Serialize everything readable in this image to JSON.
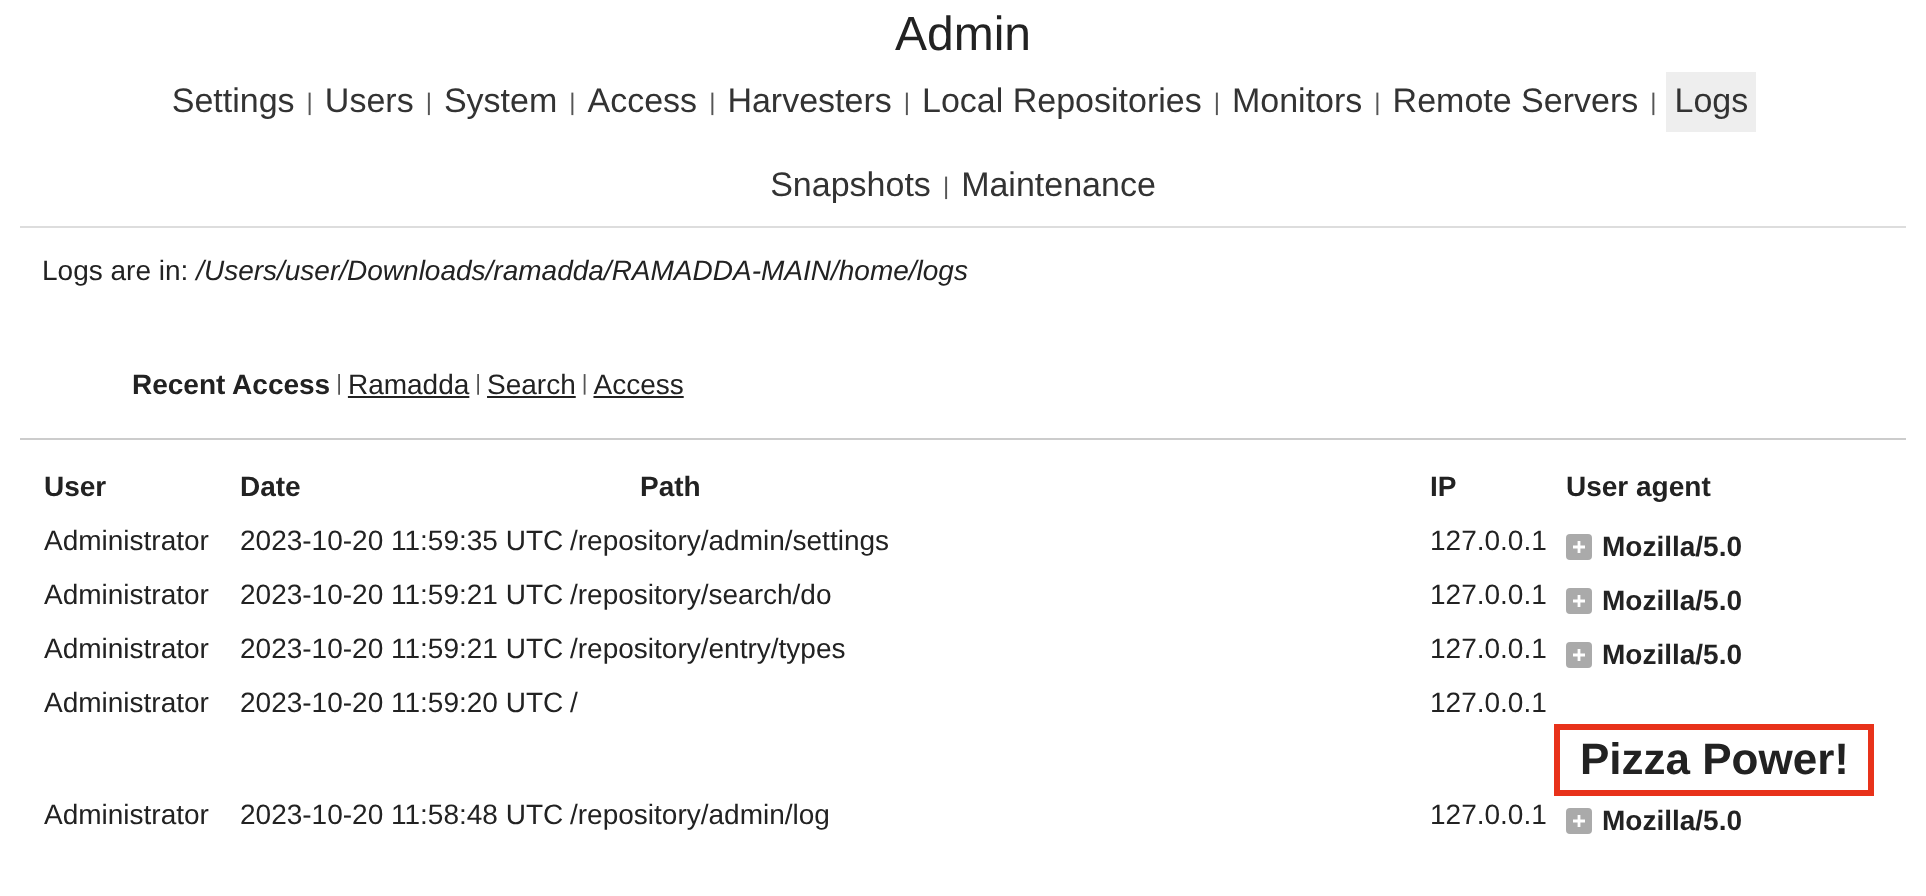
{
  "title": "Admin",
  "nav": [
    {
      "label": "Settings",
      "selected": false
    },
    {
      "separator": "|",
      "label": "Users",
      "selected": false
    },
    {
      "separator": "|",
      "label": "System",
      "selected": false
    },
    {
      "separator": "|",
      "label": "Access",
      "selected": false
    },
    {
      "separator": "|",
      "label": "Harvesters",
      "selected": false
    },
    {
      "separator": "|",
      "label": "Local Repositories",
      "selected": false
    },
    {
      "separator": "|",
      "label": "Monitors",
      "selected": false
    },
    {
      "separator": "|",
      "label": "Remote Servers",
      "selected": false
    },
    {
      "separator": "|",
      "label": "Logs",
      "selected": true
    },
    {
      "label": "Snapshots",
      "selected": false
    },
    {
      "separator": "|",
      "label": "Maintenance",
      "selected": false
    }
  ],
  "logs_location": {
    "label": "Logs are in:",
    "path": "/Users/user/Downloads/ramadda/RAMADDA-MAIN/home/logs"
  },
  "log_tabs": [
    {
      "label": "Recent Access",
      "selected": true
    },
    {
      "separator": "|",
      "label": "Ramadda",
      "selected": false
    },
    {
      "separator": "|",
      "label": "Search",
      "selected": false
    },
    {
      "separator": "|",
      "label": "Access",
      "selected": false
    }
  ],
  "table": {
    "columns": [
      "User",
      "Date",
      "Path",
      "IP",
      "User agent"
    ],
    "rows": [
      {
        "user": "Administrator",
        "date": "2023-10-20 11:59:35 UTC",
        "path": "/repository/admin/settings",
        "ip": "127.0.0.1",
        "agent": {
          "kind": "expandable",
          "text": "Mozilla/5.0"
        }
      },
      {
        "user": "Administrator",
        "date": "2023-10-20 11:59:21 UTC",
        "path": "/repository/search/do",
        "ip": "127.0.0.1",
        "agent": {
          "kind": "expandable",
          "text": "Mozilla/5.0"
        }
      },
      {
        "user": "Administrator",
        "date": "2023-10-20 11:59:21 UTC",
        "path": "/repository/entry/types",
        "ip": "127.0.0.1",
        "agent": {
          "kind": "expandable",
          "text": "Mozilla/5.0"
        }
      },
      {
        "user": "Administrator",
        "date": "2023-10-20 11:59:20 UTC",
        "path": "/",
        "ip": "127.0.0.1",
        "agent": {
          "kind": "boxed",
          "text": "Pizza Power!"
        }
      },
      {
        "user": "Administrator",
        "date": "2023-10-20 11:58:48 UTC",
        "path": "/repository/admin/log",
        "ip": "127.0.0.1",
        "agent": {
          "kind": "expandable",
          "text": "Mozilla/5.0"
        }
      }
    ]
  }
}
